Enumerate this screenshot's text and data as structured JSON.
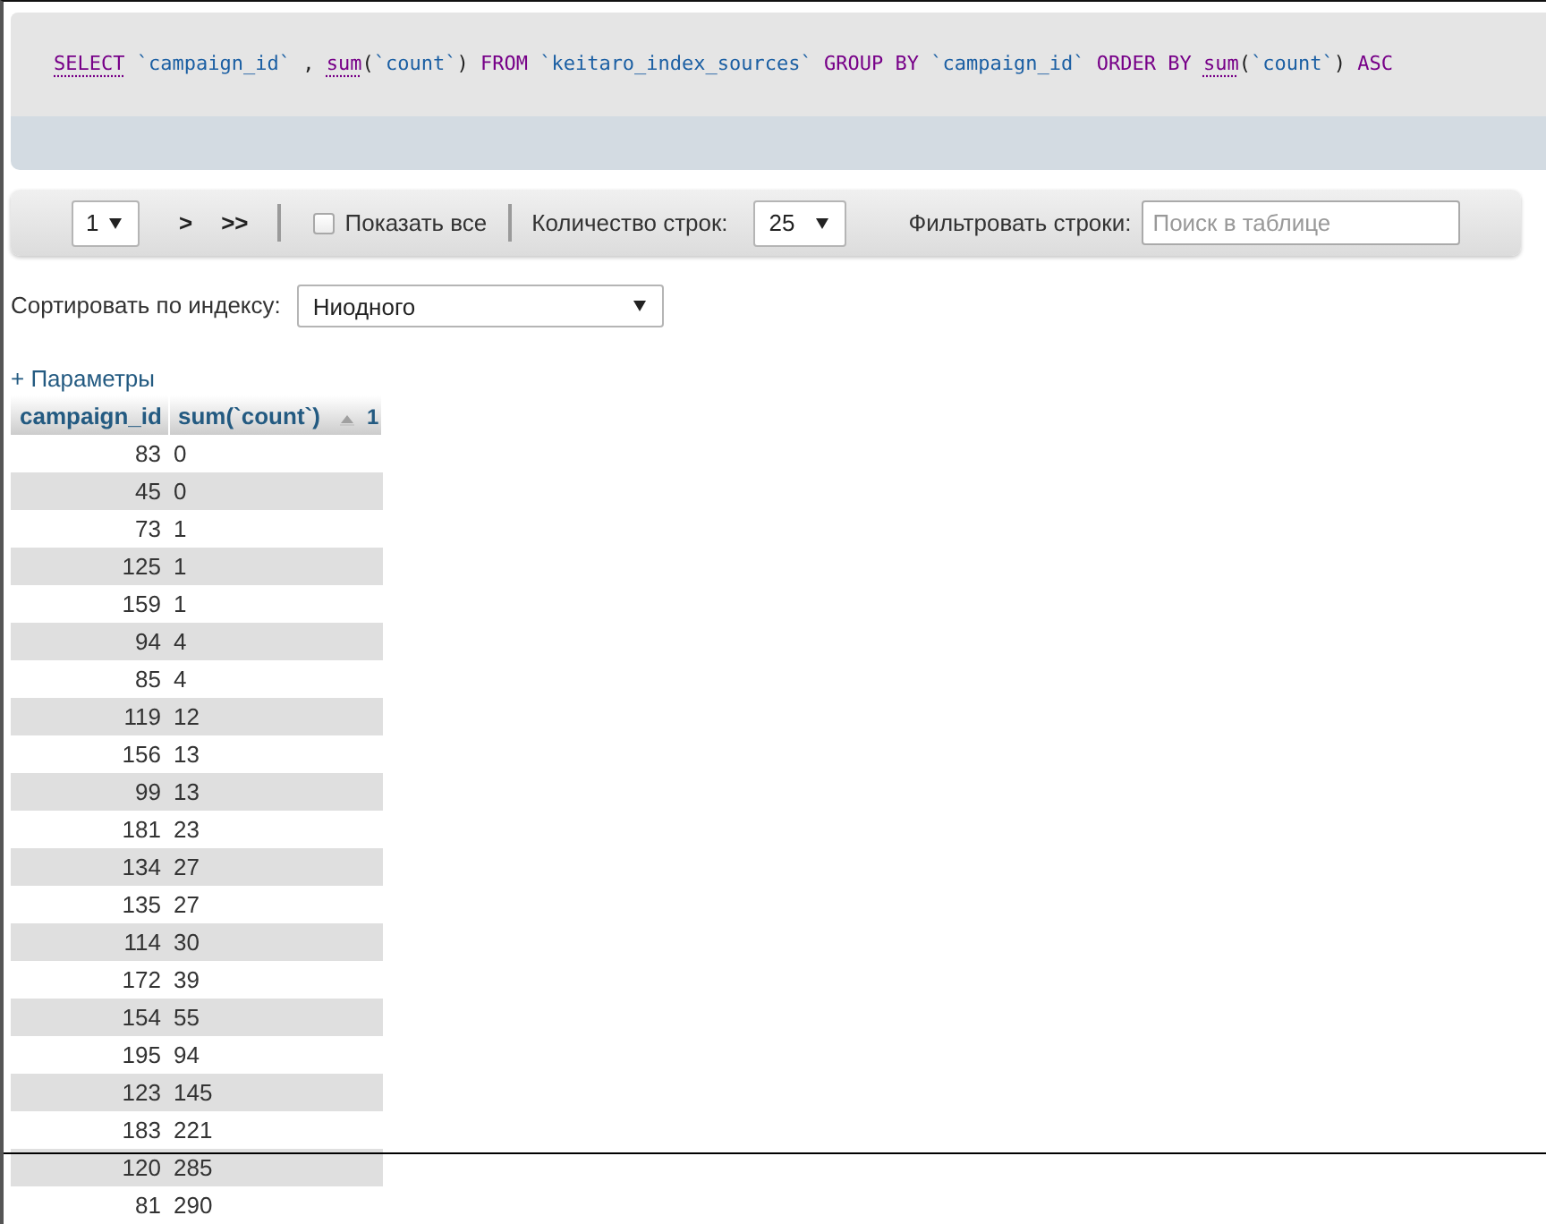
{
  "query": {
    "tokens": [
      {
        "text": "SELECT",
        "kind": "keyword",
        "linked": true
      },
      {
        "text": " `campaign_id`",
        "kind": "identifier",
        "linked": false
      },
      {
        "text": " , ",
        "kind": "plain",
        "linked": false
      },
      {
        "text": "sum",
        "kind": "keyword",
        "linked": true
      },
      {
        "text": "(",
        "kind": "plain",
        "linked": false
      },
      {
        "text": "`count`",
        "kind": "identifier",
        "linked": false
      },
      {
        "text": ") ",
        "kind": "plain",
        "linked": false
      },
      {
        "text": "FROM ",
        "kind": "keyword",
        "linked": false
      },
      {
        "text": "`keitaro_index_sources`",
        "kind": "identifier",
        "linked": false
      },
      {
        "text": " GROUP BY ",
        "kind": "keyword",
        "linked": false
      },
      {
        "text": "`campaign_id`",
        "kind": "identifier",
        "linked": false
      },
      {
        "text": " ORDER BY ",
        "kind": "keyword",
        "linked": false
      },
      {
        "text": "sum",
        "kind": "keyword",
        "linked": true
      },
      {
        "text": "(",
        "kind": "plain",
        "linked": false
      },
      {
        "text": "`count`",
        "kind": "identifier",
        "linked": false
      },
      {
        "text": ") ",
        "kind": "plain",
        "linked": false
      },
      {
        "text": "ASC",
        "kind": "keyword",
        "linked": false
      }
    ]
  },
  "navigation": {
    "page_select": {
      "value": "1"
    },
    "buttons": [
      ">",
      ">>"
    ],
    "show_all": {
      "label": "Показать все",
      "checked": false
    },
    "rows_count": {
      "label": "Количество строк:",
      "value": "25"
    },
    "filter": {
      "label": "Фильтровать строки:",
      "placeholder": "Поиск в таблице"
    }
  },
  "sort_by_index": {
    "label": "Сортировать по индексу:",
    "value": "Ниодного"
  },
  "options_link": "+ Параметры",
  "table": {
    "columns": [
      {
        "label": "campaign_id"
      },
      {
        "label": "sum(`count`)",
        "sort": {
          "ascending": true,
          "order": "1"
        }
      }
    ],
    "rows": [
      [
        "83",
        "0"
      ],
      [
        "45",
        "0"
      ],
      [
        "73",
        "1"
      ],
      [
        "125",
        "1"
      ],
      [
        "159",
        "1"
      ],
      [
        "94",
        "4"
      ],
      [
        "85",
        "4"
      ],
      [
        "119",
        "12"
      ],
      [
        "156",
        "13"
      ],
      [
        "99",
        "13"
      ],
      [
        "181",
        "23"
      ],
      [
        "134",
        "27"
      ],
      [
        "135",
        "27"
      ],
      [
        "114",
        "30"
      ],
      [
        "172",
        "39"
      ],
      [
        "154",
        "55"
      ],
      [
        "195",
        "94"
      ],
      [
        "123",
        "145"
      ],
      [
        "183",
        "221"
      ],
      [
        "120",
        "285"
      ],
      [
        "81",
        "290"
      ]
    ]
  }
}
